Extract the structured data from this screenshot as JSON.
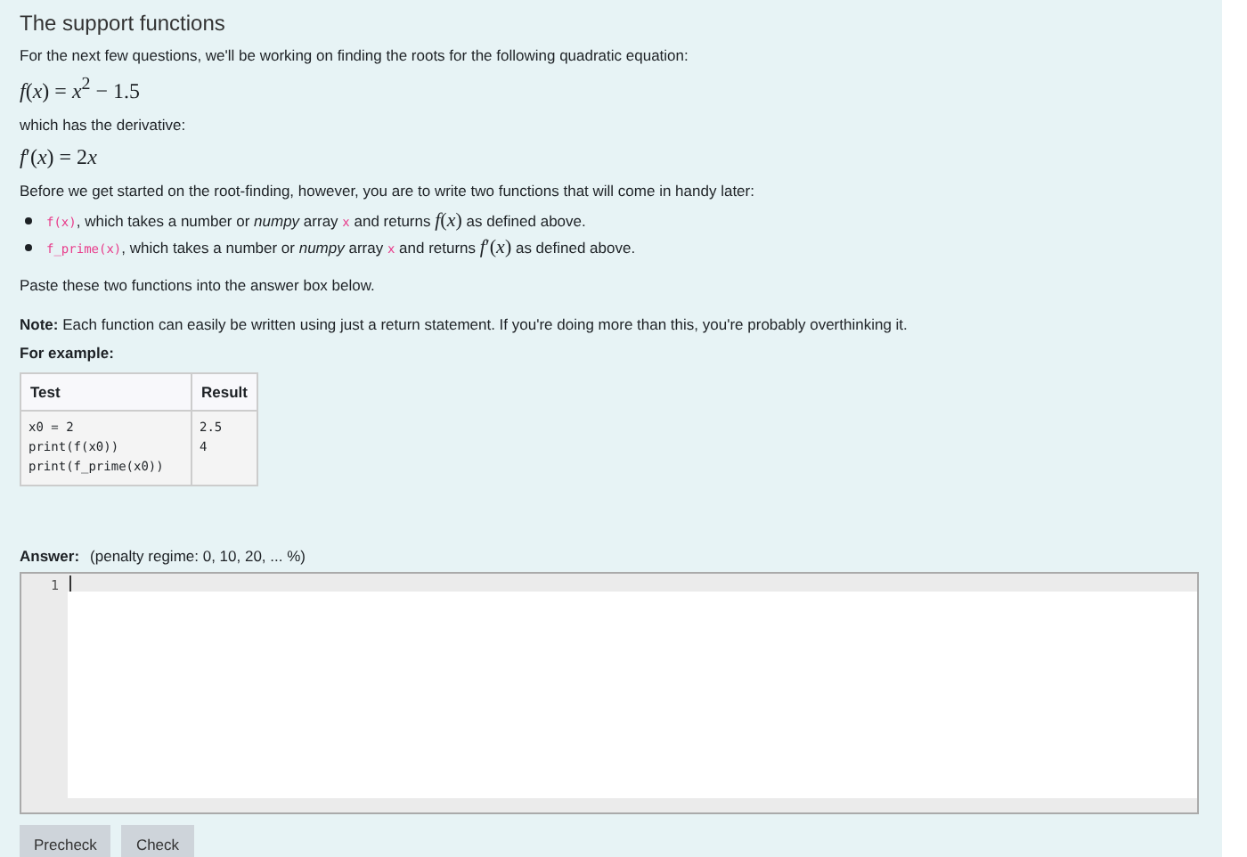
{
  "title": "The support functions",
  "intro": "For the next few questions, we'll be working on finding the roots for the following quadratic equation:",
  "equation": "*f*(*x*) = *x*$^{2}$ − 1.5",
  "derivative_intro": "which has the derivative:",
  "derivative": [
    "*f*′(*x*) = 2",
    "*x*"
  ],
  "task": "Before we get started on the root-finding, however, you are to write two functions that will come in handy later:",
  "bullets": [
    [
      {
        "kind": "code",
        "text": "f(x)"
      },
      {
        "kind": "text",
        "text": ", which takes a number or *numpy* array "
      },
      {
        "kind": "code",
        "text": "x"
      },
      {
        "kind": "text",
        "text": " and returns "
      },
      {
        "kind": "math",
        "text": "*f*(*x*)"
      },
      {
        "kind": "text",
        "text": " as defined above."
      }
    ],
    [
      {
        "kind": "code",
        "text": "f_prime(x)"
      },
      {
        "kind": "text",
        "text": ", which takes a number or *numpy* array "
      },
      {
        "kind": "code",
        "text": "x"
      },
      {
        "kind": "text",
        "text": " and returns "
      },
      {
        "kind": "math",
        "text": "*f*′(*x*)"
      },
      {
        "kind": "text",
        "text": " as defined above."
      }
    ]
  ],
  "paste": "Paste these two functions into the answer box below.",
  "note": "**Note:** Each function can easily be written using just a return statement. If you're doing more than this, you're probably overthinking it.",
  "example_label": "For example:",
  "table": {
    "columns": [
      "Test",
      "Result"
    ],
    "rows": [
      [
        "x0 = 2\nprint(f(x0))\nprint(f_prime(x0))",
        "2.5\n4"
      ]
    ]
  },
  "answer": {
    "label": "Answer:",
    "penalty": "(penalty regime: 0, 10, 20, ... %)",
    "line_numbers": [
      "1"
    ]
  },
  "buttons": [
    "Precheck",
    "Check"
  ]
}
